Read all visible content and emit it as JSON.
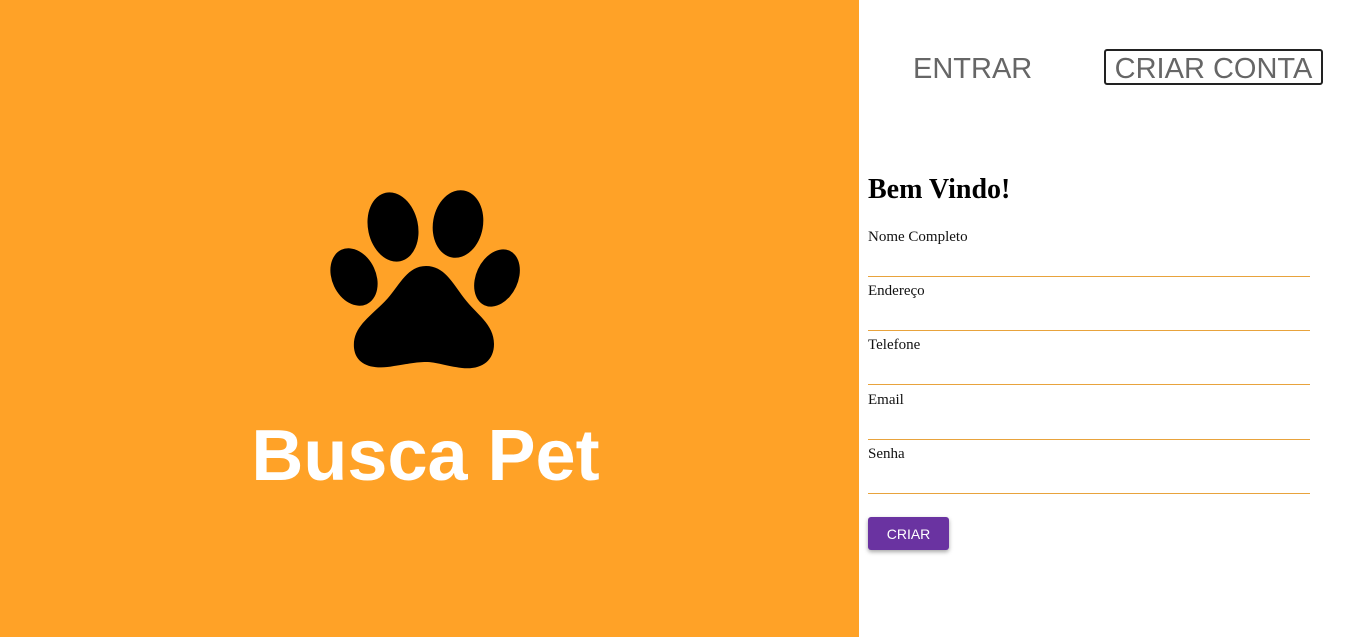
{
  "colors": {
    "hero_background": "#ffa227",
    "submit_background": "#6a33a1",
    "field_underline": "#e8a33d"
  },
  "hero": {
    "logo_icon": "paw-icon",
    "brand_name": "Busca Pet"
  },
  "tabs": {
    "login_label": "ENTRAR",
    "register_label": "CRIAR CONTA",
    "active": "CRIAR CONTA"
  },
  "form": {
    "heading": "Bem Vindo!",
    "fields": [
      {
        "label": "Nome Completo",
        "value": ""
      },
      {
        "label": "Endereço",
        "value": ""
      },
      {
        "label": "Telefone",
        "value": ""
      },
      {
        "label": "Email",
        "value": ""
      },
      {
        "label": "Senha",
        "value": ""
      }
    ],
    "submit_label": "CRIAR"
  }
}
